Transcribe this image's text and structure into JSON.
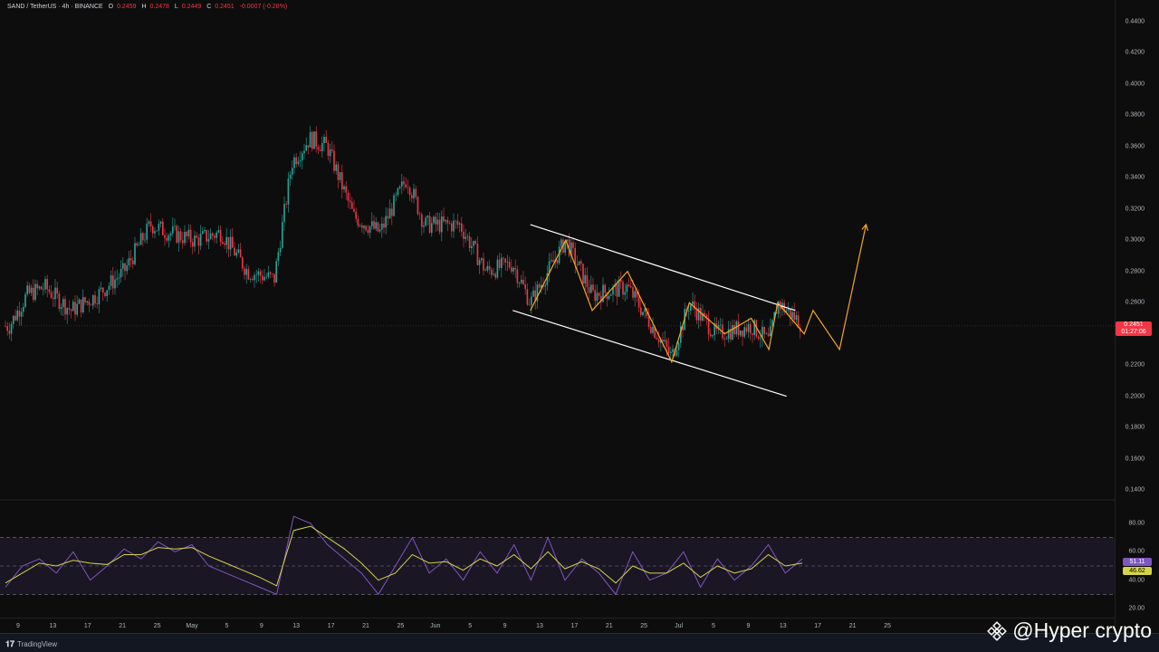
{
  "symbol_bar": {
    "pair": "SAND / TetherUS · 4h · BINANCE",
    "o_label": "O",
    "o_value": "0.2459",
    "h_label": "H",
    "h_value": "0.2478",
    "l_label": "L",
    "l_value": "0.2449",
    "c_label": "C",
    "c_value": "0.2451",
    "change": "-0.0007 (-0.28%)"
  },
  "price_axis": {
    "labels": [
      "0.4400",
      "0.4200",
      "0.4000",
      "0.3800",
      "0.3600",
      "0.3400",
      "0.3200",
      "0.3000",
      "0.2800",
      "0.2600",
      "0.2200",
      "0.2000",
      "0.1800",
      "0.1600",
      "0.1400"
    ],
    "current_price": "0.2451",
    "countdown": "01:27:06"
  },
  "rsi_axis": {
    "labels": [
      "80.00",
      "60.00",
      "40.00",
      "20.00"
    ],
    "rsi_value": "51.11",
    "ma_value": "46.62"
  },
  "time_axis": {
    "labels": [
      "9",
      "13",
      "17",
      "21",
      "25",
      "May",
      "5",
      "9",
      "13",
      "17",
      "21",
      "25",
      "Jun",
      "5",
      "9",
      "13",
      "17",
      "21",
      "25",
      "Jul",
      "5",
      "9",
      "13",
      "17",
      "21",
      "25"
    ]
  },
  "footer": {
    "brand": "TradingView"
  },
  "watermark": {
    "text": "@Hyper crypto",
    "icon": "binance-icon"
  },
  "colors": {
    "background": "#0d0d0d",
    "bull": "#26a69a",
    "bear": "#f23645",
    "channel": "#ffffff",
    "zigzag": "#f5a623",
    "rsi": "#7e57c2",
    "rsi_ma": "#d4d44a"
  },
  "chart_data": [
    {
      "type": "candlestick",
      "title": "SAND / TetherUS · 4h · BINANCE",
      "ylim": [
        0.13,
        0.45
      ],
      "close_path": [
        {
          "x": "Apr 8",
          "y": 0.245
        },
        {
          "x": "Apr 10",
          "y": 0.265
        },
        {
          "x": "Apr 12",
          "y": 0.27
        },
        {
          "x": "Apr 15",
          "y": 0.255
        },
        {
          "x": "Apr 18",
          "y": 0.265
        },
        {
          "x": "Apr 21",
          "y": 0.28
        },
        {
          "x": "Apr 24",
          "y": 0.31
        },
        {
          "x": "Apr 26",
          "y": 0.305
        },
        {
          "x": "Apr 29",
          "y": 0.3
        },
        {
          "x": "May 2",
          "y": 0.305
        },
        {
          "x": "May 5",
          "y": 0.28
        },
        {
          "x": "May 8",
          "y": 0.275
        },
        {
          "x": "May 10",
          "y": 0.35
        },
        {
          "x": "May 12",
          "y": 0.365
        },
        {
          "x": "May 14",
          "y": 0.36
        },
        {
          "x": "May 17",
          "y": 0.315
        },
        {
          "x": "May 20",
          "y": 0.305
        },
        {
          "x": "May 23",
          "y": 0.34
        },
        {
          "x": "May 25",
          "y": 0.31
        },
        {
          "x": "May 29",
          "y": 0.31
        },
        {
          "x": "Jun 1",
          "y": 0.28
        },
        {
          "x": "Jun 4",
          "y": 0.285
        },
        {
          "x": "Jun 6",
          "y": 0.26
        },
        {
          "x": "Jun 10",
          "y": 0.3
        },
        {
          "x": "Jun 13",
          "y": 0.265
        },
        {
          "x": "Jun 17",
          "y": 0.27
        },
        {
          "x": "Jun 22",
          "y": 0.225
        },
        {
          "x": "Jun 24",
          "y": 0.26
        },
        {
          "x": "Jun 27",
          "y": 0.24
        },
        {
          "x": "Jul 1",
          "y": 0.245
        },
        {
          "x": "Jul 3",
          "y": 0.235
        },
        {
          "x": "Jul 4",
          "y": 0.26
        },
        {
          "x": "Jul 7",
          "y": 0.2451
        }
      ],
      "annotations": {
        "channel_upper": [
          {
            "x": "Jun 6",
            "y": 0.31
          },
          {
            "x": "Jul 6",
            "y": 0.255
          }
        ],
        "channel_lower": [
          {
            "x": "Jun 4",
            "y": 0.255
          },
          {
            "x": "Jul 5",
            "y": 0.2
          }
        ],
        "zigzag": [
          {
            "x": "Jun 6",
            "y": 0.255
          },
          {
            "x": "Jun 10",
            "y": 0.3
          },
          {
            "x": "Jun 13",
            "y": 0.255
          },
          {
            "x": "Jun 17",
            "y": 0.28
          },
          {
            "x": "Jun 22",
            "y": 0.222
          },
          {
            "x": "Jun 24",
            "y": 0.26
          },
          {
            "x": "Jun 28",
            "y": 0.24
          },
          {
            "x": "Jul 1",
            "y": 0.25
          },
          {
            "x": "Jul 3",
            "y": 0.23
          },
          {
            "x": "Jul 4",
            "y": 0.26
          },
          {
            "x": "Jul 7",
            "y": 0.24
          },
          {
            "x": "Jul 8",
            "y": 0.255
          },
          {
            "x": "Jul 11",
            "y": 0.23
          },
          {
            "x": "Jul 14",
            "y": 0.31
          }
        ]
      }
    },
    {
      "type": "line",
      "title": "RSI",
      "ylim": [
        15,
        90
      ],
      "bands": [
        70,
        50,
        30
      ],
      "series": [
        {
          "values": [
            35,
            50,
            55,
            45,
            60,
            40,
            50,
            62,
            55,
            67,
            60,
            65,
            50,
            45,
            40,
            35,
            30,
            85,
            80,
            65,
            55,
            45,
            30,
            50,
            70,
            45,
            55,
            40,
            60,
            45,
            65,
            40,
            70,
            40,
            55,
            45,
            30,
            60,
            40,
            45,
            60,
            35,
            55,
            40,
            50,
            65,
            45,
            55
          ]
        },
        {
          "values": [
            38,
            45,
            52,
            50,
            54,
            52,
            51,
            58,
            58,
            63,
            62,
            63,
            57,
            52,
            47,
            42,
            36,
            75,
            78,
            70,
            62,
            52,
            40,
            45,
            58,
            52,
            53,
            47,
            55,
            50,
            58,
            48,
            60,
            48,
            53,
            48,
            38,
            50,
            45,
            45,
            52,
            42,
            50,
            45,
            48,
            58,
            50,
            52
          ]
        }
      ]
    }
  ]
}
